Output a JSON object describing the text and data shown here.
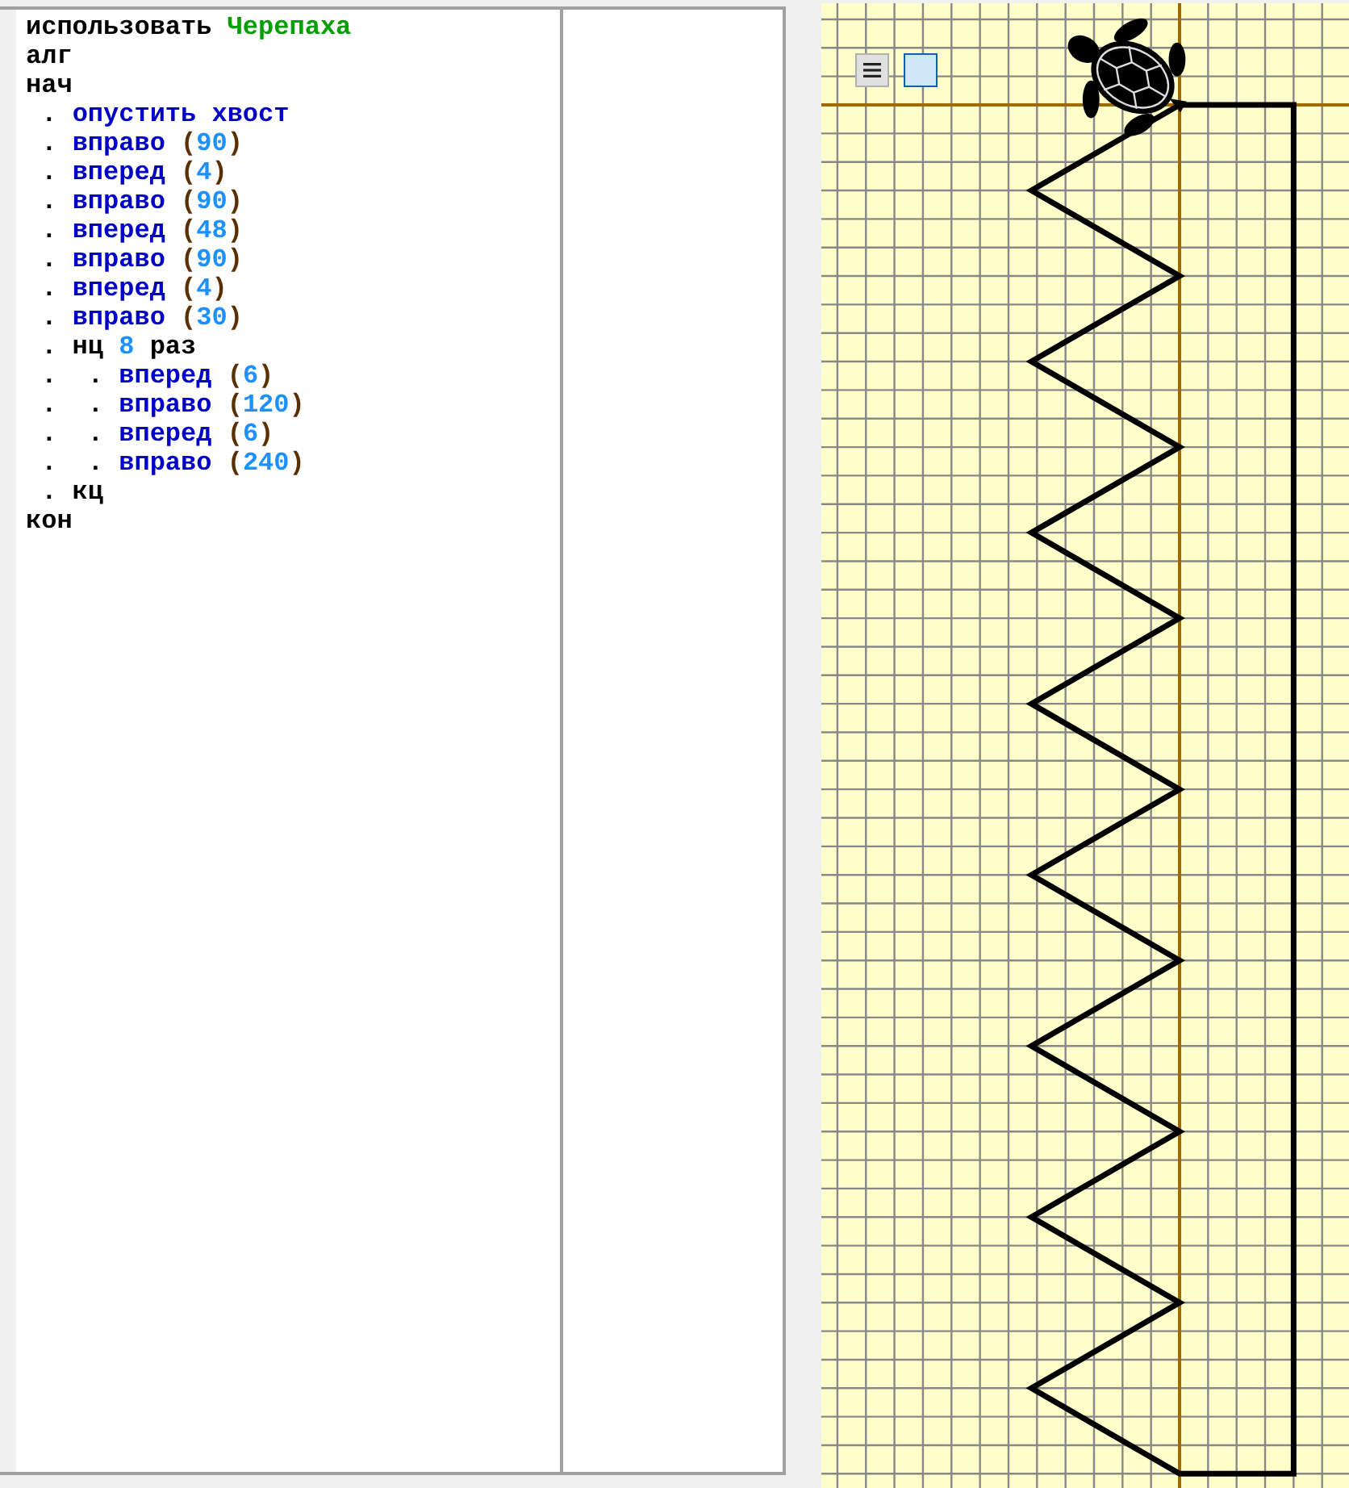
{
  "editor": {
    "lines": [
      [
        {
          "kind": "keyword",
          "text": "использовать "
        },
        {
          "kind": "module",
          "text": "Черепаха"
        }
      ],
      [
        {
          "kind": "keyword",
          "text": "алг"
        }
      ],
      [
        {
          "kind": "keyword",
          "text": "нач"
        }
      ],
      [
        {
          "kind": "keyword",
          "text": " . "
        },
        {
          "kind": "command",
          "text": "опустить хвост"
        }
      ],
      [
        {
          "kind": "keyword",
          "text": " . "
        },
        {
          "kind": "command",
          "text": "вправо "
        },
        {
          "kind": "paren",
          "text": "("
        },
        {
          "kind": "number",
          "text": "90"
        },
        {
          "kind": "paren",
          "text": ")"
        }
      ],
      [
        {
          "kind": "keyword",
          "text": " . "
        },
        {
          "kind": "command",
          "text": "вперед "
        },
        {
          "kind": "paren",
          "text": "("
        },
        {
          "kind": "number",
          "text": "4"
        },
        {
          "kind": "paren",
          "text": ")"
        }
      ],
      [
        {
          "kind": "keyword",
          "text": " . "
        },
        {
          "kind": "command",
          "text": "вправо "
        },
        {
          "kind": "paren",
          "text": "("
        },
        {
          "kind": "number",
          "text": "90"
        },
        {
          "kind": "paren",
          "text": ")"
        }
      ],
      [
        {
          "kind": "keyword",
          "text": " . "
        },
        {
          "kind": "command",
          "text": "вперед "
        },
        {
          "kind": "paren",
          "text": "("
        },
        {
          "kind": "number",
          "text": "48"
        },
        {
          "kind": "paren",
          "text": ")"
        }
      ],
      [
        {
          "kind": "keyword",
          "text": " . "
        },
        {
          "kind": "command",
          "text": "вправо "
        },
        {
          "kind": "paren",
          "text": "("
        },
        {
          "kind": "number",
          "text": "90"
        },
        {
          "kind": "paren",
          "text": ")"
        }
      ],
      [
        {
          "kind": "keyword",
          "text": " . "
        },
        {
          "kind": "command",
          "text": "вперед "
        },
        {
          "kind": "paren",
          "text": "("
        },
        {
          "kind": "number",
          "text": "4"
        },
        {
          "kind": "paren",
          "text": ")"
        }
      ],
      [
        {
          "kind": "keyword",
          "text": " . "
        },
        {
          "kind": "command",
          "text": "вправо "
        },
        {
          "kind": "paren",
          "text": "("
        },
        {
          "kind": "number",
          "text": "30"
        },
        {
          "kind": "paren",
          "text": ")"
        }
      ],
      [
        {
          "kind": "keyword",
          "text": " . нц "
        },
        {
          "kind": "number",
          "text": "8"
        },
        {
          "kind": "keyword",
          "text": " раз"
        }
      ],
      [
        {
          "kind": "keyword",
          "text": " .  . "
        },
        {
          "kind": "command",
          "text": "вперед "
        },
        {
          "kind": "paren",
          "text": "("
        },
        {
          "kind": "number",
          "text": "6"
        },
        {
          "kind": "paren",
          "text": ")"
        }
      ],
      [
        {
          "kind": "keyword",
          "text": " .  . "
        },
        {
          "kind": "command",
          "text": "вправо "
        },
        {
          "kind": "paren",
          "text": "("
        },
        {
          "kind": "number",
          "text": "120"
        },
        {
          "kind": "paren",
          "text": ")"
        }
      ],
      [
        {
          "kind": "keyword",
          "text": " .  . "
        },
        {
          "kind": "command",
          "text": "вперед "
        },
        {
          "kind": "paren",
          "text": "("
        },
        {
          "kind": "number",
          "text": "6"
        },
        {
          "kind": "paren",
          "text": ")"
        }
      ],
      [
        {
          "kind": "keyword",
          "text": " .  . "
        },
        {
          "kind": "command",
          "text": "вправо "
        },
        {
          "kind": "paren",
          "text": "("
        },
        {
          "kind": "number",
          "text": "240"
        },
        {
          "kind": "paren",
          "text": ")"
        }
      ],
      [
        {
          "kind": "keyword",
          "text": " . кц"
        }
      ],
      [
        {
          "kind": "keyword",
          "text": "кон"
        }
      ]
    ]
  }
}
